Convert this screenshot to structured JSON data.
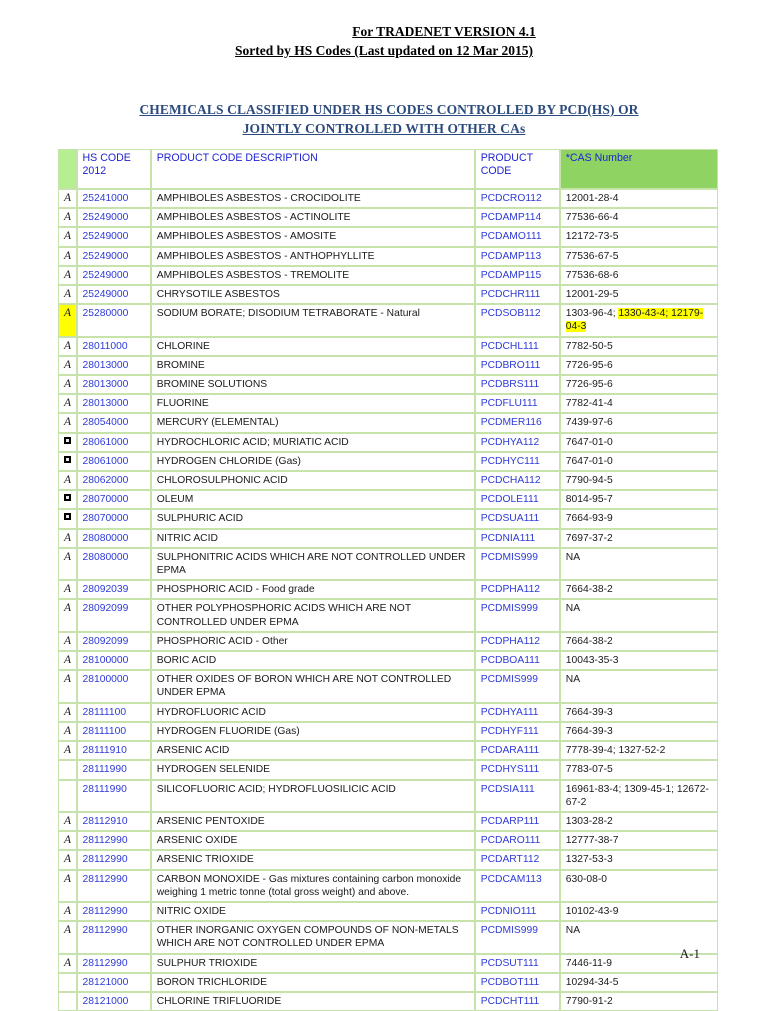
{
  "header": {
    "line1": "For TRADENET VERSION 4.1",
    "line2": "Sorted by HS Codes (Last updated on 12 Mar 2015)"
  },
  "title": {
    "line1": "CHEMICALS CLASSIFIED UNDER HS CODES CONTROLLED BY PCD(HS) OR",
    "line2": "JOINTLY CONTROLLED WITH OTHER CAs"
  },
  "table": {
    "columns": {
      "mark": "",
      "hs_code": "HS CODE 2012",
      "hs_code_line1": "HS CODE",
      "hs_code_line2": "2012",
      "description": "PRODUCT CODE DESCRIPTION",
      "product_code_line1": "PRODUCT",
      "product_code_line2": "CODE",
      "cas": "*CAS Number"
    },
    "rows": [
      {
        "mark": "A",
        "mark_highlight": false,
        "hs": "25241000",
        "desc": "AMPHIBOLES ASBESTOS - CROCIDOLITE",
        "pcode": "PCDCRO112",
        "cas": "12001-28-4",
        "cas_hl": ""
      },
      {
        "mark": "A",
        "mark_highlight": false,
        "hs": "25249000",
        "desc": "AMPHIBOLES ASBESTOS - ACTINOLITE",
        "pcode": "PCDAMP114",
        "cas": "77536-66-4",
        "cas_hl": ""
      },
      {
        "mark": "A",
        "mark_highlight": false,
        "hs": "25249000",
        "desc": "AMPHIBOLES ASBESTOS - AMOSITE",
        "pcode": "PCDAMO111",
        "cas": "12172-73-5",
        "cas_hl": ""
      },
      {
        "mark": "A",
        "mark_highlight": false,
        "hs": "25249000",
        "desc": "AMPHIBOLES ASBESTOS - ANTHOPHYLLITE",
        "pcode": "PCDAMP113",
        "cas": "77536-67-5",
        "cas_hl": ""
      },
      {
        "mark": "A",
        "mark_highlight": false,
        "hs": "25249000",
        "desc": "AMPHIBOLES ASBESTOS - TREMOLITE",
        "pcode": "PCDAMP115",
        "cas": "77536-68-6",
        "cas_hl": ""
      },
      {
        "mark": "A",
        "mark_highlight": false,
        "hs": "25249000",
        "desc": "CHRYSOTILE ASBESTOS",
        "pcode": "PCDCHR111",
        "cas": "12001-29-5",
        "cas_hl": ""
      },
      {
        "mark": "A",
        "mark_highlight": true,
        "hs": "25280000",
        "desc": "SODIUM BORATE; DISODIUM TETRABORATE - Natural",
        "pcode": "PCDSOB112",
        "cas": "1303-96-4; ",
        "cas_hl": "1330-43-4; 12179-04-3"
      },
      {
        "mark": "A",
        "mark_highlight": false,
        "hs": "28011000",
        "desc": "CHLORINE",
        "pcode": "PCDCHL111",
        "cas": "7782-50-5",
        "cas_hl": ""
      },
      {
        "mark": "A",
        "mark_highlight": false,
        "hs": "28013000",
        "desc": "BROMINE",
        "pcode": "PCDBRO111",
        "cas": "7726-95-6",
        "cas_hl": ""
      },
      {
        "mark": "A",
        "mark_highlight": false,
        "hs": "28013000",
        "desc": "BROMINE SOLUTIONS",
        "pcode": "PCDBRS111",
        "cas": "7726-95-6",
        "cas_hl": ""
      },
      {
        "mark": "A",
        "mark_highlight": false,
        "hs": "28013000",
        "desc": "FLUORINE",
        "pcode": "PCDFLU111",
        "cas": "7782-41-4",
        "cas_hl": ""
      },
      {
        "mark": "A",
        "mark_highlight": false,
        "hs": "28054000",
        "desc": "MERCURY (ELEMENTAL)",
        "pcode": "PCDMER116",
        "cas": "7439-97-6",
        "cas_hl": ""
      },
      {
        "mark": "SQUARE",
        "mark_highlight": false,
        "hs": "28061000",
        "desc": "HYDROCHLORIC ACID; MURIATIC ACID",
        "pcode": "PCDHYA112",
        "cas": "7647-01-0",
        "cas_hl": ""
      },
      {
        "mark": "SQUARE",
        "mark_highlight": false,
        "hs": "28061000",
        "desc": "HYDROGEN CHLORIDE (Gas)",
        "pcode": "PCDHYC111",
        "cas": "7647-01-0",
        "cas_hl": ""
      },
      {
        "mark": "A",
        "mark_highlight": false,
        "hs": "28062000",
        "desc": "CHLOROSULPHONIC ACID",
        "pcode": "PCDCHA112",
        "cas": "7790-94-5",
        "cas_hl": ""
      },
      {
        "mark": "SQUARE",
        "mark_highlight": false,
        "hs": "28070000",
        "desc": "OLEUM",
        "pcode": "PCDOLE111",
        "cas": "8014-95-7",
        "cas_hl": ""
      },
      {
        "mark": "SQUARE",
        "mark_highlight": false,
        "hs": "28070000",
        "desc": "SULPHURIC ACID",
        "pcode": "PCDSUA111",
        "cas": "7664-93-9",
        "cas_hl": ""
      },
      {
        "mark": "A",
        "mark_highlight": false,
        "hs": "28080000",
        "desc": "NITRIC ACID",
        "pcode": "PCDNIA111",
        "cas": "7697-37-2",
        "cas_hl": ""
      },
      {
        "mark": "A",
        "mark_highlight": false,
        "hs": "28080000",
        "desc": "SULPHONITRIC ACIDS WHICH ARE NOT CONTROLLED UNDER EPMA",
        "pcode": "PCDMIS999",
        "cas": "NA",
        "cas_hl": ""
      },
      {
        "mark": "A",
        "mark_highlight": false,
        "hs": "28092039",
        "desc": "PHOSPHORIC ACID - Food grade",
        "pcode": "PCDPHA112",
        "cas": "7664-38-2",
        "cas_hl": ""
      },
      {
        "mark": "A",
        "mark_highlight": false,
        "hs": "28092099",
        "desc": "OTHER POLYPHOSPHORIC ACIDS WHICH ARE NOT CONTROLLED UNDER EPMA",
        "pcode": "PCDMIS999",
        "cas": "NA",
        "cas_hl": ""
      },
      {
        "mark": "A",
        "mark_highlight": false,
        "hs": "28092099",
        "desc": "PHOSPHORIC ACID - Other",
        "pcode": "PCDPHA112",
        "cas": "7664-38-2",
        "cas_hl": ""
      },
      {
        "mark": "A",
        "mark_highlight": false,
        "hs": "28100000",
        "desc": "BORIC ACID",
        "pcode": "PCDBOA111",
        "cas": "10043-35-3",
        "cas_hl": ""
      },
      {
        "mark": "A",
        "mark_highlight": false,
        "hs": "28100000",
        "desc": "OTHER OXIDES OF BORON WHICH ARE NOT CONTROLLED UNDER EPMA",
        "pcode": "PCDMIS999",
        "cas": "NA",
        "cas_hl": ""
      },
      {
        "mark": "A",
        "mark_highlight": false,
        "hs": "28111100",
        "desc": "HYDROFLUORIC ACID",
        "pcode": "PCDHYA111",
        "cas": "7664-39-3",
        "cas_hl": ""
      },
      {
        "mark": "A",
        "mark_highlight": false,
        "hs": "28111100",
        "desc": "HYDROGEN FLUORIDE (Gas)",
        "pcode": "PCDHYF111",
        "cas": "7664-39-3",
        "cas_hl": ""
      },
      {
        "mark": "A",
        "mark_highlight": false,
        "hs": "28111910",
        "desc": "ARSENIC ACID",
        "pcode": "PCDARA111",
        "cas": "7778-39-4; 1327-52-2",
        "cas_hl": ""
      },
      {
        "mark": "",
        "mark_highlight": false,
        "hs": "28111990",
        "desc": "HYDROGEN SELENIDE",
        "pcode": "PCDHYS111",
        "cas": "7783-07-5",
        "cas_hl": ""
      },
      {
        "mark": "",
        "mark_highlight": false,
        "hs": "28111990",
        "desc": "SILICOFLUORIC ACID; HYDROFLUOSILICIC ACID",
        "pcode": "PCDSIA111",
        "cas": "16961-83-4; 1309-45-1; 12672-67-2",
        "cas_hl": ""
      },
      {
        "mark": "A",
        "mark_highlight": false,
        "hs": "28112910",
        "desc": "ARSENIC PENTOXIDE",
        "pcode": "PCDARP111",
        "cas": "1303-28-2",
        "cas_hl": ""
      },
      {
        "mark": "A",
        "mark_highlight": false,
        "hs": "28112990",
        "desc": "ARSENIC OXIDE",
        "pcode": "PCDARO111",
        "cas": "12777-38-7",
        "cas_hl": ""
      },
      {
        "mark": "A",
        "mark_highlight": false,
        "hs": "28112990",
        "desc": "ARSENIC TRIOXIDE",
        "pcode": "PCDART112",
        "cas": "1327-53-3",
        "cas_hl": ""
      },
      {
        "mark": "A",
        "mark_highlight": false,
        "hs": "28112990",
        "desc": "CARBON MONOXIDE - Gas mixtures containing carbon monoxide weighing 1 metric tonne (total gross weight) and above.",
        "pcode": "PCDCAM113",
        "cas": "630-08-0",
        "cas_hl": ""
      },
      {
        "mark": "A",
        "mark_highlight": false,
        "hs": "28112990",
        "desc": "NITRIC OXIDE",
        "pcode": "PCDNIO111",
        "cas": "10102-43-9",
        "cas_hl": ""
      },
      {
        "mark": "A",
        "mark_highlight": false,
        "hs": "28112990",
        "desc": "OTHER INORGANIC OXYGEN COMPOUNDS OF NON-METALS WHICH ARE NOT CONTROLLED UNDER EPMA",
        "pcode": "PCDMIS999",
        "cas": "NA",
        "cas_hl": ""
      },
      {
        "mark": "A",
        "mark_highlight": false,
        "hs": "28112990",
        "desc": "SULPHUR TRIOXIDE",
        "pcode": "PCDSUT111",
        "cas": "7446-11-9",
        "cas_hl": ""
      },
      {
        "mark": "",
        "mark_highlight": false,
        "hs": "28121000",
        "desc": "BORON TRICHLORIDE",
        "pcode": "PCDBOT111",
        "cas": "10294-34-5",
        "cas_hl": ""
      },
      {
        "mark": "",
        "mark_highlight": false,
        "hs": "28121000",
        "desc": "CHLORINE TRIFLUORIDE",
        "pcode": "PCDCHT111",
        "cas": "7790-91-2",
        "cas_hl": ""
      }
    ]
  },
  "footer": {
    "page_label": "A-1"
  },
  "colors": {
    "header_green": "#b6ee92",
    "cas_header_green": "#8fd463",
    "border_green": "#c6e3ab",
    "link_blue": "#2e3ad6",
    "title_blue": "#2b4a7d",
    "highlight_yellow": "#ffff00"
  }
}
